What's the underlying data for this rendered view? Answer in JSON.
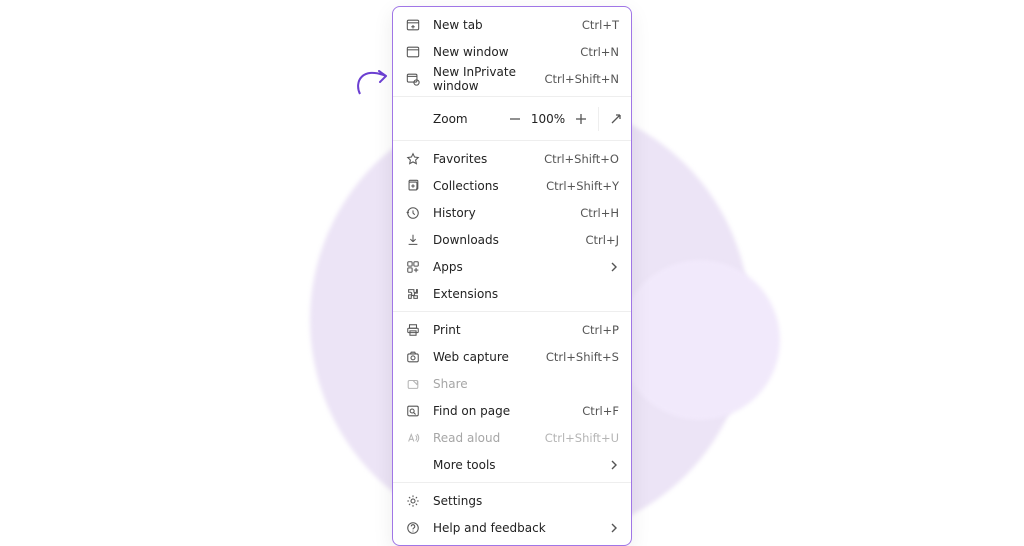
{
  "menu": {
    "new_tab": {
      "label": "New tab",
      "shortcut": "Ctrl+T"
    },
    "new_window": {
      "label": "New window",
      "shortcut": "Ctrl+N"
    },
    "new_inprivate": {
      "label": "New InPrivate window",
      "shortcut": "Ctrl+Shift+N"
    },
    "zoom": {
      "label": "Zoom",
      "value": "100%"
    },
    "favorites": {
      "label": "Favorites",
      "shortcut": "Ctrl+Shift+O"
    },
    "collections": {
      "label": "Collections",
      "shortcut": "Ctrl+Shift+Y"
    },
    "history": {
      "label": "History",
      "shortcut": "Ctrl+H"
    },
    "downloads": {
      "label": "Downloads",
      "shortcut": "Ctrl+J"
    },
    "apps": {
      "label": "Apps"
    },
    "extensions": {
      "label": "Extensions"
    },
    "print": {
      "label": "Print",
      "shortcut": "Ctrl+P"
    },
    "web_capture": {
      "label": "Web capture",
      "shortcut": "Ctrl+Shift+S"
    },
    "share": {
      "label": "Share"
    },
    "find": {
      "label": "Find on page",
      "shortcut": "Ctrl+F"
    },
    "read_aloud": {
      "label": "Read aloud",
      "shortcut": "Ctrl+Shift+U"
    },
    "more_tools": {
      "label": "More tools"
    },
    "settings": {
      "label": "Settings"
    },
    "help": {
      "label": "Help and feedback"
    }
  }
}
